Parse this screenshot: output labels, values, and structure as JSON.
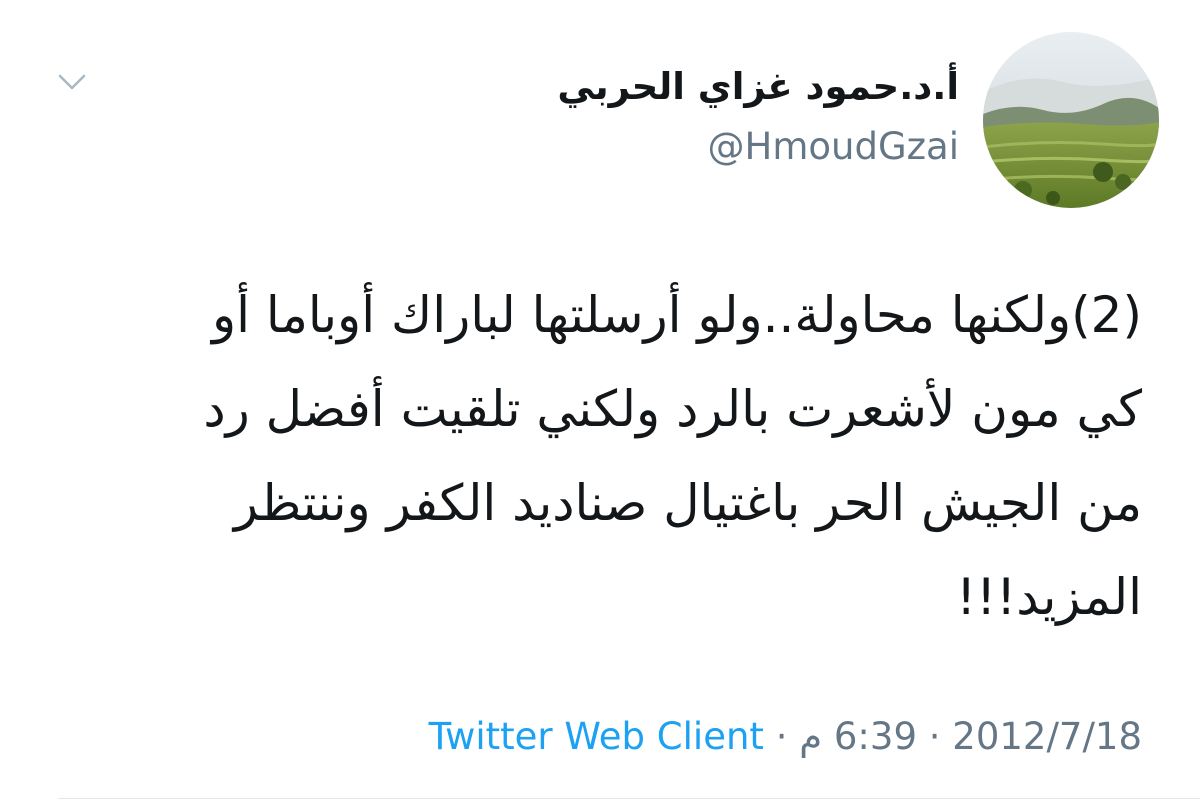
{
  "author": {
    "name": "أ.د.حمود غزاي الحربي",
    "handle": "@HmoudGzai",
    "avatar_icon": "landscape-avatar-icon"
  },
  "tweet": {
    "lines": [
      "(2)ولكنها محاولة..ولو أرسلتها لباراك أوباما أو",
      "كي مون لأشعرت بالرد ولكني تلقيت أفضل رد",
      "من الجيش الحر باغتيال صناديد الكفر وننتظر",
      "المزيد!!!"
    ],
    "date": "2012/7/18",
    "time": "6:39 م",
    "separator": "·",
    "source": "Twitter Web Client"
  },
  "colors": {
    "text": "#14171a",
    "secondary": "#657786",
    "link": "#1da1f2"
  }
}
